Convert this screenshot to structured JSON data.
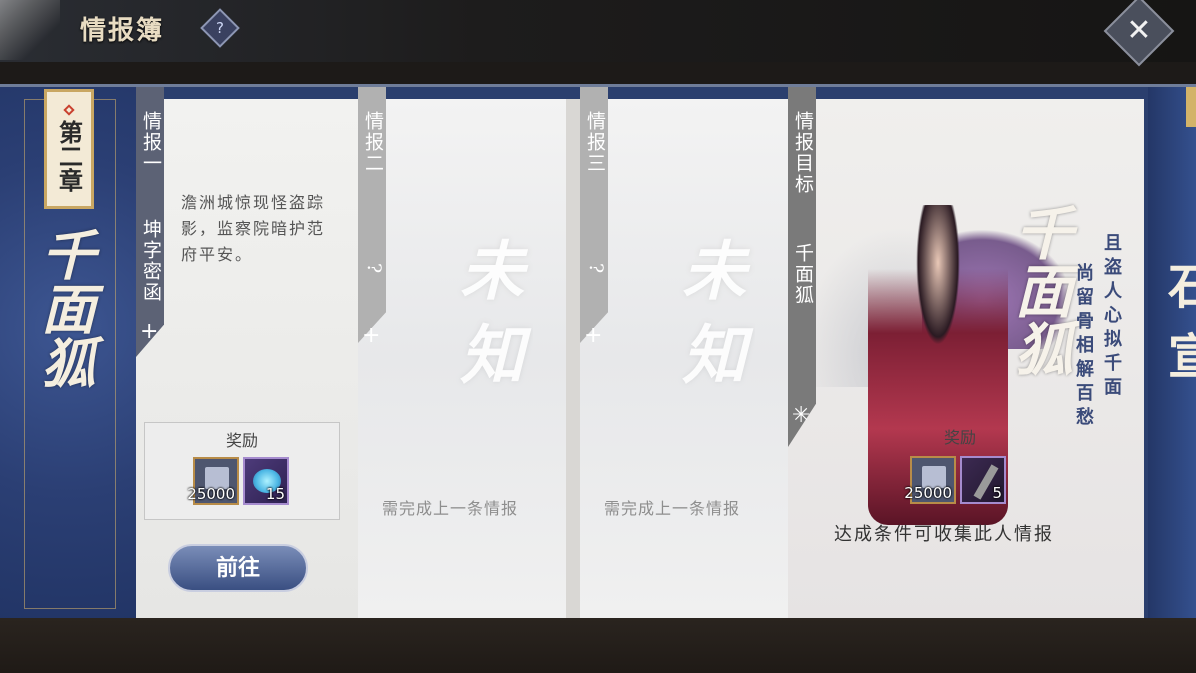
{
  "header": {
    "title": "情报簿",
    "help_icon": "question-mark-icon",
    "close_icon": "close-icon"
  },
  "chapter": {
    "label": "第二章",
    "calligraphy": "千面狐"
  },
  "intel_pages": [
    {
      "tab_title": "情报一",
      "tab_subtitle": "坤字密函",
      "description": "澹洲城惊现怪盗踪影，监察院暗护范府平安。",
      "reward_label": "奖励",
      "rewards": [
        {
          "icon": "silver-notes-icon",
          "count": "25000"
        },
        {
          "icon": "blue-gem-icon",
          "count": "15"
        }
      ],
      "button_label": "前往"
    },
    {
      "tab_title": "情报二",
      "tab_subtitle": "?",
      "unknown_text": "未知",
      "requirement": "需完成上一条情报"
    },
    {
      "tab_title": "情报三",
      "tab_subtitle": "?",
      "unknown_text": "未知",
      "requirement": "需完成上一条情报"
    }
  ],
  "target": {
    "tab_title": "情报目标",
    "tab_subtitle": "千面狐",
    "calligraphy": "千面狐",
    "poem_right": "且盗人心拟千面",
    "poem_left": "尚留骨相解百愁",
    "reward_label": "奖励",
    "rewards": [
      {
        "icon": "silver-notes-icon",
        "count": "25000"
      },
      {
        "icon": "dark-wand-icon",
        "count": "5"
      }
    ],
    "condition": "达成条件可收集此人情报"
  },
  "right_edge_calligraphy": "石宣"
}
